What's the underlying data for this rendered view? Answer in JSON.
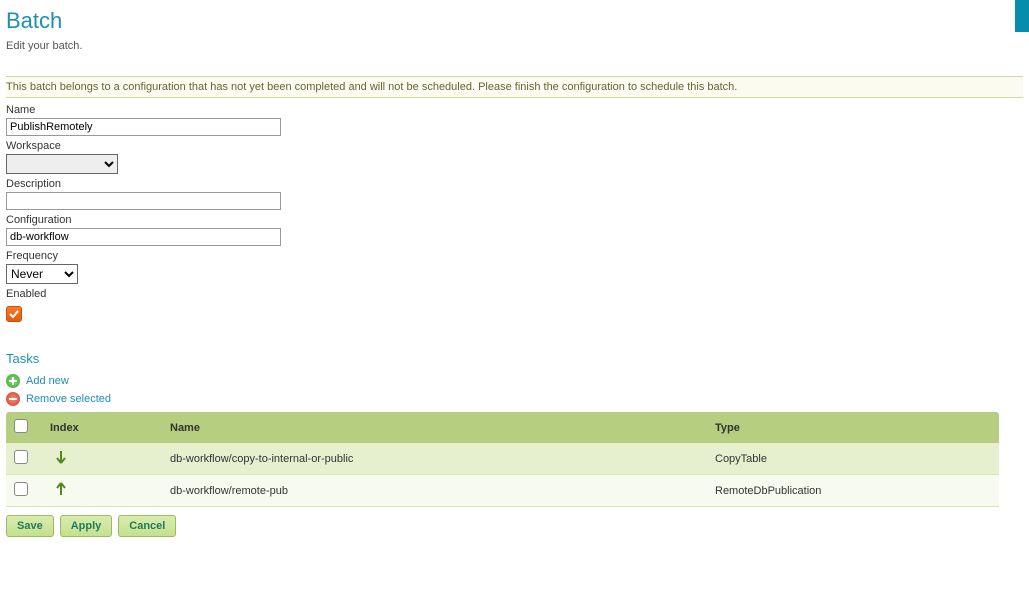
{
  "header": {
    "title": "Batch",
    "subtitle": "Edit your batch."
  },
  "warning": "This batch belongs to a configuration that has not yet been completed and will not be scheduled. Please finish the configuration to schedule this batch.",
  "form": {
    "name_label": "Name",
    "name_value": "PublishRemotely",
    "workspace_label": "Workspace",
    "workspace_value": "",
    "description_label": "Description",
    "description_value": "",
    "configuration_label": "Configuration",
    "configuration_value": "db-workflow",
    "frequency_label": "Frequency",
    "frequency_value": "Never",
    "enabled_label": "Enabled",
    "enabled_checked": true
  },
  "tasks": {
    "section_title": "Tasks",
    "add_label": "Add new",
    "remove_label": "Remove selected",
    "headers": {
      "index": "Index",
      "name": "Name",
      "type": "Type"
    },
    "rows": [
      {
        "arrow": "down",
        "name": "db-workflow/copy-to-internal-or-public",
        "type": "CopyTable"
      },
      {
        "arrow": "up",
        "name": "db-workflow/remote-pub",
        "type": "RemoteDbPublication"
      }
    ]
  },
  "buttons": {
    "save": "Save",
    "apply": "Apply",
    "cancel": "Cancel"
  }
}
